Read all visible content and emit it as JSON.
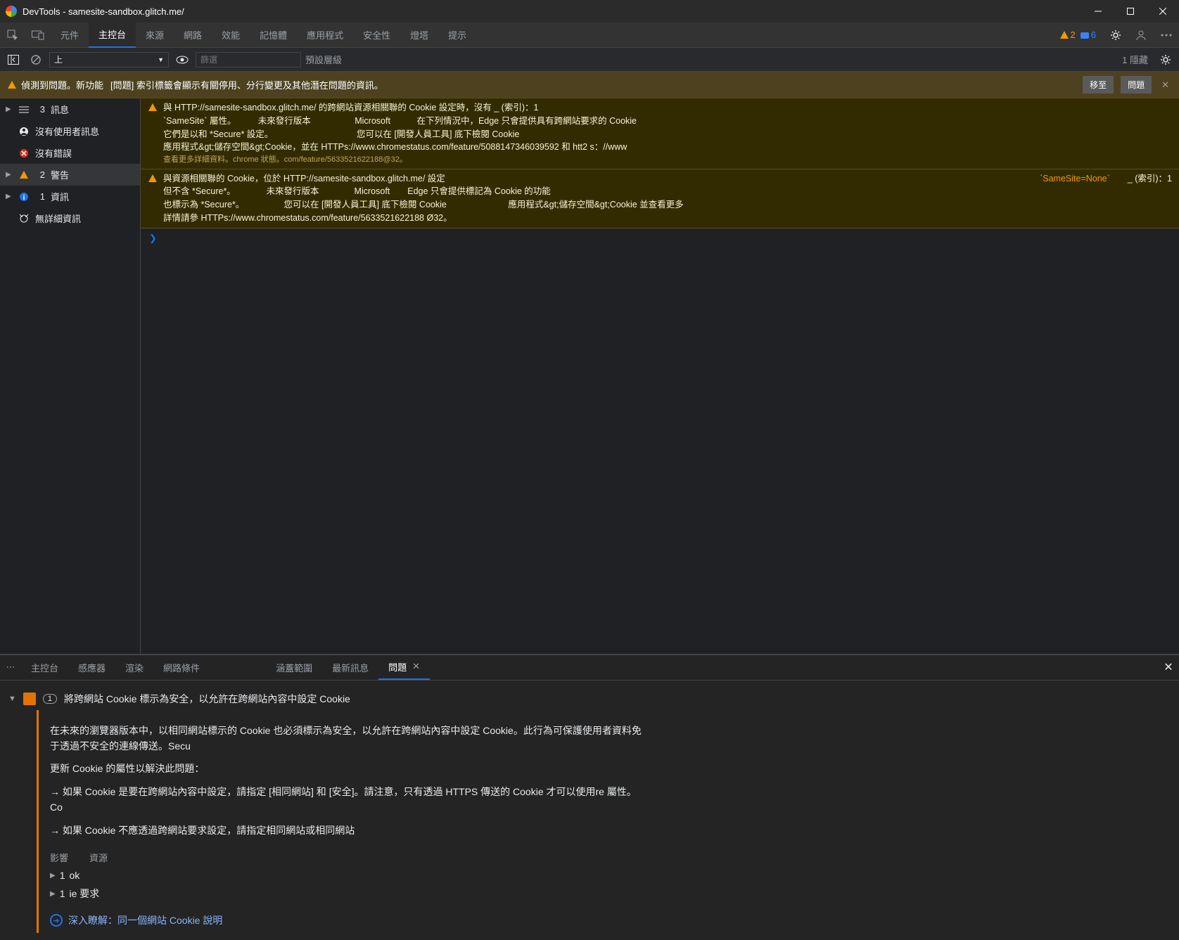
{
  "titlebar": {
    "title": "DevTools - samesite-sandbox.glitch.me/"
  },
  "tabs": {
    "items": [
      "元件",
      "主控台",
      "來源",
      "網路",
      "效能",
      "記憶體",
      "應用程式",
      "安全性",
      "燈塔",
      "提示"
    ],
    "active": 1,
    "warnCount": "2",
    "infoCount": "6"
  },
  "toolbar": {
    "context": "上",
    "filterPlaceholder": "篩選",
    "levels": "預設層級",
    "hidden": "1 隱藏"
  },
  "infobar": {
    "label": "偵測到問題。新功能",
    "text": "[問題] 索引標籤會顯示有關停用、分行變更及其他潛在問題的資訊。",
    "goto": "移至",
    "issues": "問題"
  },
  "sidebar": {
    "messages": {
      "count": "3",
      "label": "訊息"
    },
    "user": {
      "label": "沒有使用者訊息"
    },
    "errors": {
      "label": "沒有錯誤"
    },
    "warnings": {
      "count": "2",
      "label": "警告"
    },
    "info": {
      "count": "1",
      "label": "資訊"
    },
    "verbose": {
      "label": "無詳細資訊"
    }
  },
  "msgs": {
    "m1a": "與 HTTP://samesite-sandbox.glitch.me/ 的跨網站資源相關聯的 Cookie 設定時，沒有 _ (索引)：1",
    "m1b": "`SameSite` 屬性。　　　未來發行版本　　　　　Microsoft　　　在下列情況中，Edge 只會提供具有跨網站要求的 Cookie",
    "m1c": "它們是以和 *Secure* 設定。　　　　　　　　　　您可以在 [開發人員工具] 底下檢閱 Cookie",
    "m1d": "應用程式&gt;儲存空間&gt;Cookie，並在 HTTPs://www.chromestatus.com/feature/5088147346039592 和 htt2 s：//www",
    "m1e": "查看更多詳細資料。chrome 狀態。com/feature/5633521622188@32。",
    "m2a": "與資源相關聯的 Cookie，位於 HTTP://samesite-sandbox.glitch.me/ 設定",
    "m2r": "`SameSite=None`　　_ (索引)：1",
    "m2b": "但不含 *Secure*。　　　　未來發行版本　　　　Microsoft　　Edge 只會提供標記為 Cookie 的功能",
    "m2c": "也標示為 *Secure*。　　　　　您可以在 [開發人員工具] 底下檢閱 Cookie　　　　　　　應用程式&gt;儲存空間&gt;Cookie 並查看更多",
    "m2d": "詳情請參 HTTPs://www.chromestatus.com/feature/5633521622188 Ø32。"
  },
  "drawer": {
    "tabs": [
      "主控台",
      "感應器",
      "渲染",
      "網路條件",
      "涵蓋範圍",
      "最新訊息",
      "問題"
    ],
    "active": 6
  },
  "issue": {
    "count": "1",
    "title": "將跨網站 Cookie 標示為安全，以允許在跨網站內容中設定 Cookie",
    "p1": "在未來的瀏覽器版本中，以相同網站標示的 Cookie 也必須標示為安全，以允許在跨網站內容中設定 Cookie。此行為可保護使用者資料免于透過不安全的連線傳送。Secu",
    "p2": "更新 Cookie 的屬性以解決此問題：",
    "p3": "→ 如果 Cookie 是要在跨網站內容中設定，請指定 [相同網站] 和 [安全]。請注意，只有透過 HTTPS 傳送的 Cookie 才可以使用re 屬性。Co",
    "p4": "→ 如果 Cookie 不應透過跨網站要求設定，請指定相同網站或相同網站",
    "subAffect": "影響",
    "subRes": "資源",
    "res1c": "1",
    "res1t": "ok",
    "res2c": "1",
    "res2t": "ie 要求",
    "learnLabel": "深入瞭解：",
    "learnLink": "同一個網站 Cookie 說明"
  }
}
